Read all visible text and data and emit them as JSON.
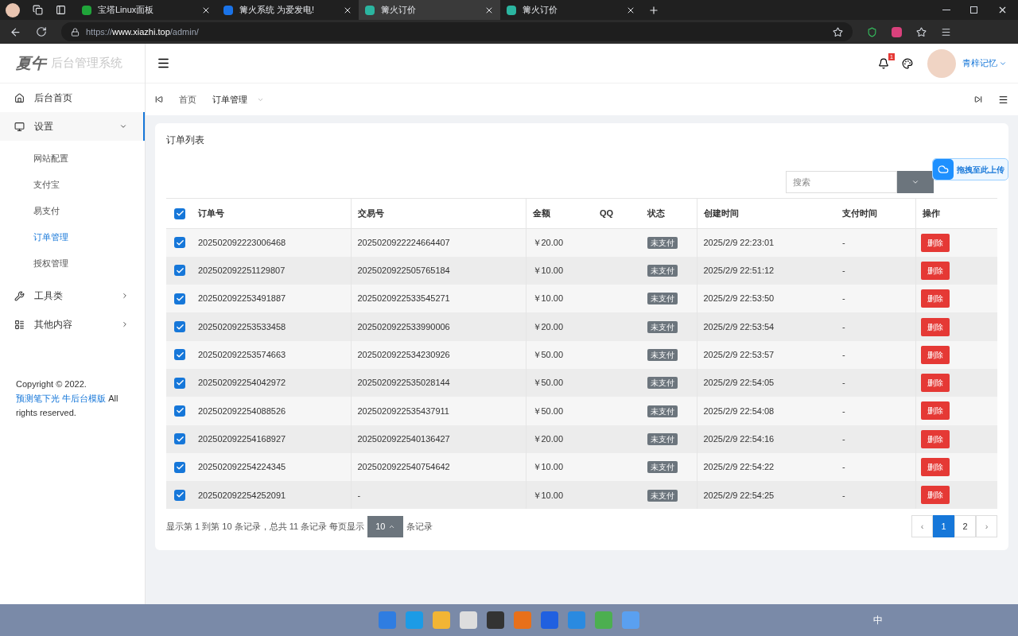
{
  "browser": {
    "tabs": [
      {
        "title": "宝塔Linux面板",
        "selected": false
      },
      {
        "title": "篝火系统 为爱发电!",
        "selected": false
      },
      {
        "title": "篝火订价",
        "selected": true
      },
      {
        "title": "篝火订价",
        "selected": false
      }
    ],
    "url_prefix": "https://",
    "url_host": "www.xiazhi.top",
    "url_path": "/admin/"
  },
  "logo": {
    "mark": "夏午",
    "title": "后台管理系统"
  },
  "user": {
    "name": "青梓记忆",
    "notifications": "1"
  },
  "sidebar": {
    "items": [
      {
        "label": "后台首页",
        "expanded": false,
        "has_arrow": false
      },
      {
        "label": "设置",
        "expanded": true,
        "has_arrow": true,
        "children": [
          {
            "label": "网站配置",
            "selected": false
          },
          {
            "label": "支付宝",
            "selected": false
          },
          {
            "label": "易支付",
            "selected": false
          },
          {
            "label": "订单管理",
            "selected": true
          },
          {
            "label": "授权管理",
            "selected": false
          }
        ]
      },
      {
        "label": "工具类",
        "expanded": false,
        "has_arrow": true
      },
      {
        "label": "其他内容",
        "expanded": false,
        "has_arrow": true
      }
    ],
    "footer_start": "Copyright © 2022.",
    "footer_link": "预测笔下光 牛后台模版",
    "footer_end": "All rights reserved."
  },
  "page_tabs": [
    {
      "label": "首页",
      "selected": false
    },
    {
      "label": "订单管理",
      "selected": true
    }
  ],
  "card": {
    "title": "订单列表",
    "search_placeholder": "搜索",
    "upload_hint": "拖拽至此上传"
  },
  "table": {
    "all_checked": true,
    "columns": [
      "订单号",
      "交易号",
      "金额",
      "QQ",
      "状态",
      "创建时间",
      "支付时间",
      "操作"
    ],
    "rows": [
      {
        "checked": true,
        "order": "202502092223006468",
        "trade": "2025020922224664407",
        "amount": "￥20.00",
        "qq": "",
        "status": "未支付",
        "created": "2025/2/9 22:23:01",
        "paid": "-",
        "action": "删除"
      },
      {
        "checked": true,
        "order": "202502092251129807",
        "trade": "2025020922505765184",
        "amount": "￥10.00",
        "qq": "",
        "status": "未支付",
        "created": "2025/2/9 22:51:12",
        "paid": "-",
        "action": "删除"
      },
      {
        "checked": true,
        "order": "202502092253491887",
        "trade": "2025020922533545271",
        "amount": "￥10.00",
        "qq": "",
        "status": "未支付",
        "created": "2025/2/9 22:53:50",
        "paid": "-",
        "action": "删除"
      },
      {
        "checked": true,
        "order": "202502092253533458",
        "trade": "2025020922533990006",
        "amount": "￥20.00",
        "qq": "",
        "status": "未支付",
        "created": "2025/2/9 22:53:54",
        "paid": "-",
        "action": "删除"
      },
      {
        "checked": true,
        "order": "202502092253574663",
        "trade": "2025020922534230926",
        "amount": "￥50.00",
        "qq": "",
        "status": "未支付",
        "created": "2025/2/9 22:53:57",
        "paid": "-",
        "action": "删除"
      },
      {
        "checked": true,
        "order": "202502092254042972",
        "trade": "2025020922535028144",
        "amount": "￥50.00",
        "qq": "",
        "status": "未支付",
        "created": "2025/2/9 22:54:05",
        "paid": "-",
        "action": "删除"
      },
      {
        "checked": true,
        "order": "202502092254088526",
        "trade": "2025020922535437911",
        "amount": "￥50.00",
        "qq": "",
        "status": "未支付",
        "created": "2025/2/9 22:54:08",
        "paid": "-",
        "action": "删除"
      },
      {
        "checked": true,
        "order": "202502092254168927",
        "trade": "2025020922540136427",
        "amount": "￥20.00",
        "qq": "",
        "status": "未支付",
        "created": "2025/2/9 22:54:16",
        "paid": "-",
        "action": "删除"
      },
      {
        "checked": true,
        "order": "202502092254224345",
        "trade": "2025020922540754642",
        "amount": "￥10.00",
        "qq": "",
        "status": "未支付",
        "created": "2025/2/9 22:54:22",
        "paid": "-",
        "action": "删除"
      },
      {
        "checked": true,
        "order": "202502092254252091",
        "trade": "-",
        "amount": "￥10.00",
        "qq": "",
        "status": "未支付",
        "created": "2025/2/9 22:54:25",
        "paid": "-",
        "action": "删除"
      }
    ]
  },
  "pagination": {
    "summary": "显示第 1 到第 10 条记录，总共 11 条记录 每页显示",
    "page_size": "10",
    "suffix": "条记录",
    "prev": "‹",
    "next": "›",
    "pages": [
      {
        "label": "1",
        "selected": true
      },
      {
        "label": "2",
        "selected": false
      }
    ]
  },
  "taskbar": {
    "ime": "中"
  }
}
